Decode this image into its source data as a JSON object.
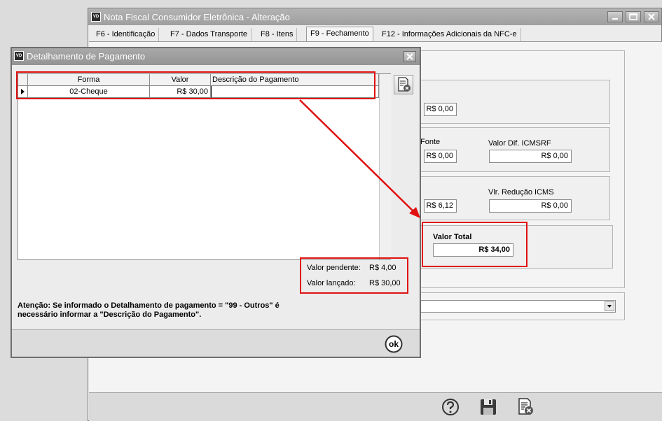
{
  "main_window": {
    "title": "Nota Fiscal Consumidor Eletrônica - Alteração",
    "icon_text": "VD",
    "tabs": [
      {
        "label": "F6 - Identificação"
      },
      {
        "label": "F7 - Dados Transporte"
      },
      {
        "label": "F8 - Itens"
      },
      {
        "label": "F9 - Fechamento",
        "active": true
      },
      {
        "label": "F12 - Informações Adicionais da NFC-e"
      }
    ],
    "fields": {
      "value_1": "R$ 0,00",
      "label_fonte": "Fonte",
      "value_2": "R$ 0,00",
      "label_valor_dif_icmsrf": "Valor Dif. ICMSRF",
      "valor_dif_icmsrf": "R$ 0,00",
      "value_3": "R$ 6,12",
      "label_vlr_reducao_icms": "Vlr. Redução ICMS",
      "vlr_reducao_icms": "R$ 0,00",
      "label_valor_total": "Valor Total",
      "valor_total": "R$ 34,00"
    },
    "combo_value": ""
  },
  "dialog": {
    "title": "Detalhamento de Pagamento",
    "icon_text": "VD",
    "columns": [
      "Forma",
      "Valor",
      "Descrição do Pagamento"
    ],
    "rows": [
      {
        "forma": "02-Cheque",
        "valor": "R$ 30,00",
        "descricao": ""
      }
    ],
    "summary": {
      "pendente_label": "Valor pendente:",
      "pendente_value": "R$ 4,00",
      "lancado_label": "Valor lançado:",
      "lancado_value": "R$ 30,00"
    },
    "warning_line1": "Atenção: Se informado o Detalhamento de pagamento = \"99 - Outros\" é",
    "warning_line2": "necessário informar a \"Descrição do Pagamento\".",
    "ok_label": "ok"
  },
  "colors": {
    "highlight": "#e01010",
    "titlebar": "#a0a0a0"
  },
  "icons": [
    "app-icon",
    "minimize-icon",
    "restore-icon",
    "close-icon",
    "delete-record-icon",
    "help-icon",
    "save-icon",
    "ok-icon",
    "row-pointer-icon",
    "combo-arrow-icon"
  ]
}
